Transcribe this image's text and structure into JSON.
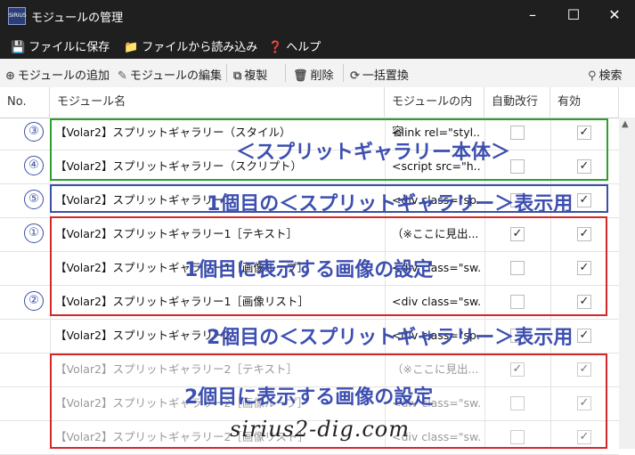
{
  "window": {
    "app_icon_text": "SIRIUS",
    "title": "モジュールの管理"
  },
  "menubar": [
    {
      "icon": "save-icon",
      "label": "ファイルに保存"
    },
    {
      "icon": "folder-icon",
      "label": "ファイルから読み込み"
    },
    {
      "icon": "help-icon",
      "label": "ヘルプ"
    }
  ],
  "toolbar": {
    "add": "モジュールの追加",
    "edit": "モジュールの編集",
    "copy": "複製",
    "delete": "削除",
    "replace": "一括置換",
    "search": "検索"
  },
  "columns": {
    "no": "No.",
    "name": "モジュール名",
    "content": "モジュールの内容",
    "auto": "自動改行",
    "valid": "有効"
  },
  "rows": [
    {
      "num": "③",
      "name": "【Volar2】スプリットギャラリー（スタイル）",
      "content": "<link rel=\"styl...",
      "auto": false,
      "valid": true
    },
    {
      "num": "④",
      "name": "【Volar2】スプリットギャラリー（スクリプト）",
      "content": "<script src=\"h...",
      "auto": false,
      "valid": true
    },
    {
      "num": "⑤",
      "name": "【Volar2】スプリットギャラリー1",
      "content": "<div class=\"sp...",
      "auto": false,
      "valid": true
    },
    {
      "num": "①",
      "name": "【Volar2】スプリットギャラリー1［テキスト］",
      "content": "（※ここに見出...",
      "auto": true,
      "valid": true
    },
    {
      "num": "",
      "name": "【Volar2】スプリットギャラリー1［画像ループ］",
      "content": "<div class=\"sw...",
      "auto": false,
      "valid": true
    },
    {
      "num": "②",
      "name": "【Volar2】スプリットギャラリー1［画像リスト］",
      "content": "<div class=\"sw...",
      "auto": false,
      "valid": true
    },
    {
      "num": "",
      "name": "【Volar2】スプリットギャラリー2",
      "content": "<div class=\"sp...",
      "auto": false,
      "valid": true
    },
    {
      "num": "",
      "name": "【Volar2】スプリットギャラリー2［テキスト］",
      "content": "（※ここに見出...",
      "auto": true,
      "valid": true
    },
    {
      "num": "",
      "name": "【Volar2】スプリットギャラリー2［画像ループ］",
      "content": "<div class=\"sw...",
      "auto": false,
      "valid": true
    },
    {
      "num": "",
      "name": "【Volar2】スプリットギャラリー2［画像リスト］",
      "content": "<div class=\"sw...",
      "auto": false,
      "valid": true
    }
  ],
  "annotations": {
    "green": "＜スプリットギャラリー本体＞",
    "blue": "1個目の＜スプリットギャラリー＞表示用",
    "red1": "1個目に表示する画像の設定",
    "dark": "2個目の＜スプリットギャラリー＞表示用",
    "red2": "2個目に表示する画像の設定"
  },
  "watermark": "sirius2-dig.com",
  "colors": {
    "titlebar": "#1f1f1f",
    "green_box": "#2ca02c",
    "blue_box": "#3a4fa8",
    "red_box": "#d62728",
    "annotation_text": "#3d4fb0"
  }
}
